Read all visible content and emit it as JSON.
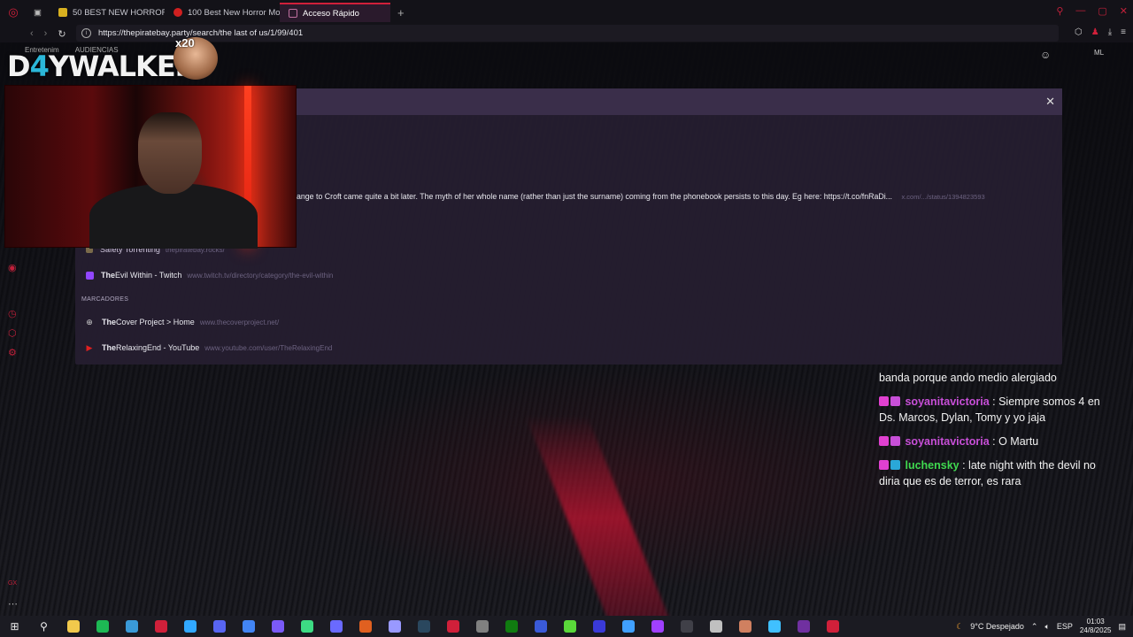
{
  "browser": {
    "tabs": [
      {
        "label": "50 BEST NEW HORROR M",
        "color": "#d8b020"
      },
      {
        "label": "100 Best New Horror Mov",
        "color": "#d02020"
      },
      {
        "label": "Acceso Rápido",
        "color": "#c070a0"
      }
    ],
    "new_tab_symbol": "+",
    "url": "https://thepiratebay.party/search/the last of us/1/99/401",
    "profile_label": "ML",
    "bookmarks": [
      "Entretenim",
      "AUDIENCIAS"
    ]
  },
  "dropdown": {
    "snippet_text": "ange to Croft came quite a bit later. The myth of her whole name (rather than just the surname) coming from the phonebook persists to this day. Eg here: https://t.co/fnRaDi...",
    "snippet_url": "x.com/.../status/1394823593",
    "rows_history": [
      {
        "title": "Safety Torrenting",
        "url": "thepiratebay.rocks/",
        "icon_color": "#7a6a4a"
      },
      {
        "title_bold": "The",
        "title_rest": " Evil Within - Twitch",
        "url": "www.twitch.tv/directory/category/the-evil-within",
        "icon_color": "#9146ff"
      }
    ],
    "section_label": "MARCADORES",
    "rows_bookmarks": [
      {
        "title_bold": "The",
        "title_rest": " Cover Project > Home",
        "url": "www.thecoverproject.net/",
        "icon_color": "#cfcfcf"
      },
      {
        "title_bold": "The",
        "title_rest": "RelaxingEnd - YouTube",
        "url": "www.youtube.com/user/TheRelaxingEnd",
        "icon_color": "#e02020"
      }
    ]
  },
  "overlay": {
    "brand": {
      "part1": "D",
      "part2": "4",
      "part3": "YWALKER"
    },
    "multiplier": "x20"
  },
  "chat": {
    "partial_line": "banda porque ando medio alergiado",
    "messages": [
      {
        "user": "soyanitavictoria",
        "text": " : Siempre somos 4 en Ds. Marcos, Dylan, Tomy y yo jaja",
        "color": "#c84fd8",
        "badge2": "#c84fd8"
      },
      {
        "user": "soyanitavictoria",
        "text": " : O Martu",
        "color": "#c84fd8",
        "badge2": "#c84fd8"
      },
      {
        "user": "luchensky",
        "text": " : late night with the devil no diria que es de terror, es rara",
        "color": "#3fd84f",
        "badge2": "#2aa8d8"
      }
    ],
    "badge_color": "#e040d0"
  },
  "taskbar": {
    "weather": "9°C  Despejado",
    "lang": "ESP",
    "time": "01:03",
    "date": "24/8/2025",
    "apps": [
      "#f2c94c",
      "#1db954",
      "#3a9ad8",
      "#d0203a",
      "#31a8ff",
      "#5865f2",
      "#4285f4",
      "#7a5af8",
      "#3ddc84",
      "#6a6aff",
      "#e06020",
      "#9999ff",
      "#2a475e",
      "#d0203a",
      "#808080",
      "#107c10",
      "#3a5ad8",
      "#5ad83a",
      "#3a3ad8",
      "#40a0ff",
      "#a040ff",
      "#404048",
      "#c0c0c0",
      "#d08060",
      "#40c0ff",
      "#7030a0",
      "#d0203a"
    ]
  }
}
